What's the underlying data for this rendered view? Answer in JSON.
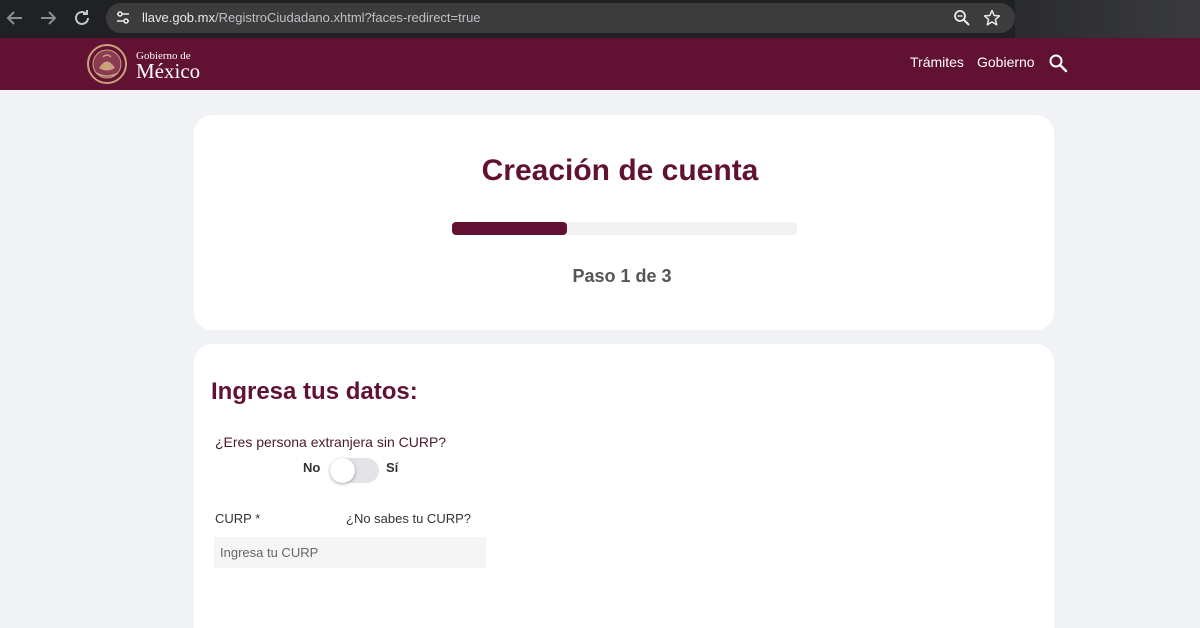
{
  "browser": {
    "url_host": "llave.gob.mx",
    "url_path": "/RegistroCiudadano.xhtml?faces-redirect=true",
    "icons": [
      "back-arrow-icon",
      "forward-arrow-icon",
      "reload-icon",
      "site-settings-icon",
      "zoom-icon",
      "bookmark-star-icon"
    ]
  },
  "gov_header": {
    "logo_line1": "Gobierno de",
    "logo_line2": "México",
    "nav": [
      "Trámites",
      "Gobierno"
    ],
    "icons": [
      "coat-of-arms-icon",
      "search-icon"
    ]
  },
  "registration": {
    "title": "Creación de cuenta",
    "step_text": "Paso 1 de 3",
    "progress_fraction": 0.333
  },
  "form": {
    "heading": "Ingresa tus datos:",
    "foreigner_question": "¿Eres persona extranjera sin CURP?",
    "toggle_no": "No",
    "toggle_si": "Sí",
    "toggle_value": "No",
    "curp_label": "CURP *",
    "curp_help_link": "¿No sabes tu CURP?",
    "curp_placeholder": "Ingresa tu CURP",
    "curp_value": ""
  },
  "colors": {
    "brand": "#611232",
    "chrome": "#202124",
    "page_bg": "#f1f2f6"
  }
}
